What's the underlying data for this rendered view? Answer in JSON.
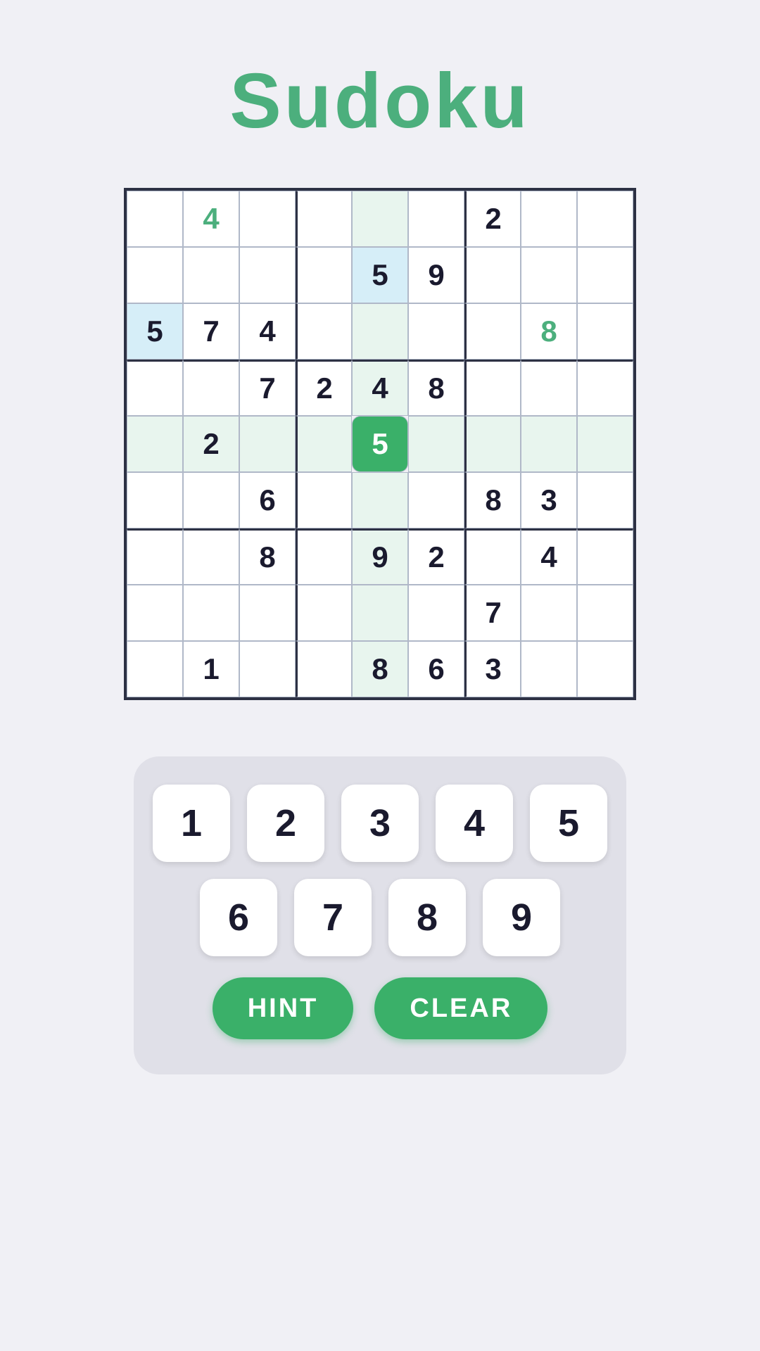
{
  "title": "Sudoku",
  "grid": {
    "cells": [
      [
        null,
        "4",
        null,
        null,
        null,
        null,
        "2",
        null,
        null
      ],
      [
        null,
        null,
        null,
        null,
        "5",
        "9",
        null,
        null,
        null
      ],
      [
        "5",
        "7",
        "4",
        null,
        null,
        null,
        null,
        "8",
        null
      ],
      [
        null,
        null,
        "7",
        "2",
        "4",
        "8",
        null,
        null,
        null
      ],
      [
        null,
        "2",
        null,
        null,
        "5",
        null,
        null,
        null,
        null
      ],
      [
        null,
        null,
        "6",
        null,
        null,
        null,
        "8",
        "3",
        null
      ],
      [
        null,
        null,
        "8",
        null,
        "9",
        "2",
        null,
        "4",
        null
      ],
      [
        null,
        null,
        null,
        null,
        null,
        null,
        "7",
        null,
        null
      ],
      [
        null,
        "1",
        null,
        null,
        "8",
        "6",
        "3",
        null,
        null
      ]
    ],
    "selected_row": 4,
    "selected_col": 4,
    "col_highlight": 4,
    "row_highlight": 4,
    "blue_cells": [
      [
        1,
        4
      ],
      [
        2,
        0
      ]
    ],
    "green_cells": [
      [
        0,
        1
      ],
      [
        2,
        7
      ]
    ],
    "given_color": "#1a1a2e"
  },
  "numpad": {
    "rows": [
      [
        "1",
        "2",
        "3",
        "4",
        "5"
      ],
      [
        "6",
        "7",
        "8",
        "9"
      ]
    ],
    "hint_label": "HINT",
    "clear_label": "CLEAR"
  }
}
